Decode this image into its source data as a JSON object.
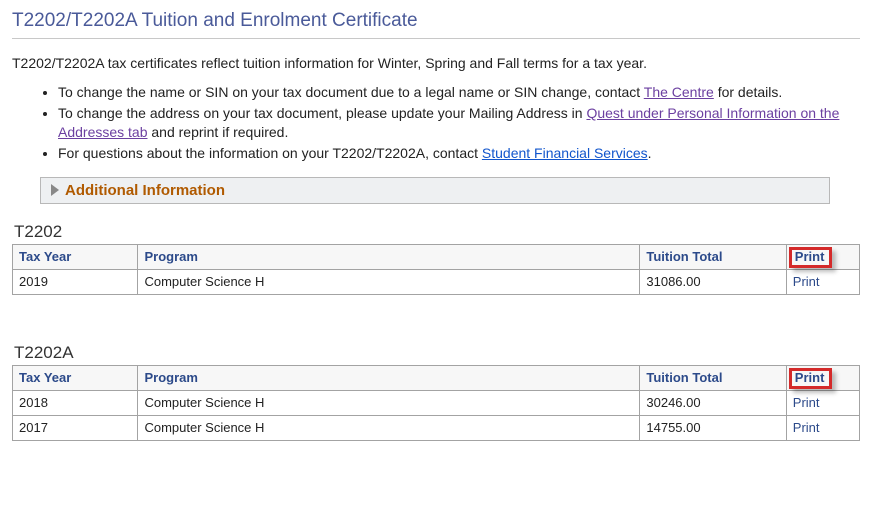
{
  "title": "T2202/T2202A Tuition and Enrolment Certificate",
  "intro": "T2202/T2202A tax certificates reflect tuition information for Winter, Spring and Fall terms for a tax year.",
  "bullets": {
    "b1_pre": "To change the name or SIN on your tax document due to a legal name or SIN change, contact ",
    "b1_link": "The Centre",
    "b1_post": " for details.",
    "b2_pre": "To change the address on your tax document, please update your Mailing Address in ",
    "b2_link": "Quest under Personal Information on the Addresses tab",
    "b2_post": " and reprint if required.",
    "b3_pre": "For questions about the information on your T2202/T2202A, contact ",
    "b3_link": "Student Financial Services",
    "b3_post": "."
  },
  "accordion_label": "Additional Information",
  "headers": {
    "tax_year": "Tax Year",
    "program": "Program",
    "tuition_total": "Tuition Total",
    "print": "Print"
  },
  "print_label": "Print",
  "t2202": {
    "label": "T2202",
    "rows": [
      {
        "year": "2019",
        "program": "Computer Science H",
        "tuition": "31086.00"
      }
    ]
  },
  "t2202a": {
    "label": "T2202A",
    "rows": [
      {
        "year": "2018",
        "program": "Computer Science H",
        "tuition": "30246.00"
      },
      {
        "year": "2017",
        "program": "Computer Science H",
        "tuition": "14755.00"
      }
    ]
  }
}
